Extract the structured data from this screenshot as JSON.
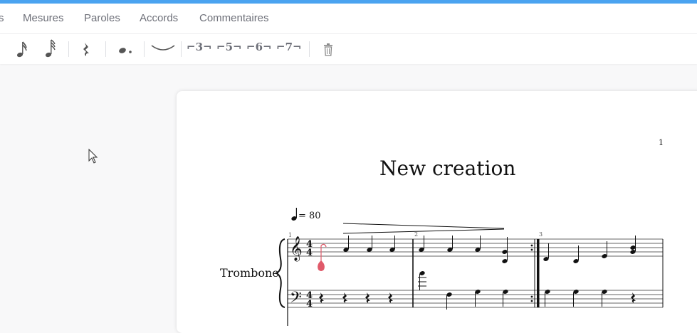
{
  "menu": {
    "items": [
      {
        "id": "partial",
        "label": "s"
      },
      {
        "id": "mesures",
        "label": "Mesures"
      },
      {
        "id": "paroles",
        "label": "Paroles"
      },
      {
        "id": "accords",
        "label": "Accords"
      },
      {
        "id": "commentaires",
        "label": "Commentaires"
      }
    ]
  },
  "toolbar": {
    "tools": [
      "sixteenth-note-icon",
      "thirty-second-note-icon",
      "quarter-rest-icon",
      "dot-icon",
      "tie-icon",
      "trash-icon"
    ],
    "tuplets": [
      "⌐3¬",
      "⌐5¬",
      "⌐6¬",
      "⌐7¬"
    ]
  },
  "score": {
    "title": "New creation",
    "page_number": "1",
    "instrument": "Trombone",
    "tempo_value": "= 80",
    "measure_numbers": [
      "1",
      "2",
      "3"
    ],
    "time_signature": {
      "top": "4",
      "bottom": "4"
    }
  },
  "colors": {
    "accent_bar": "#4aa3f0",
    "selected_note": "#e05a6a",
    "menu_text": "#6d6f78"
  }
}
